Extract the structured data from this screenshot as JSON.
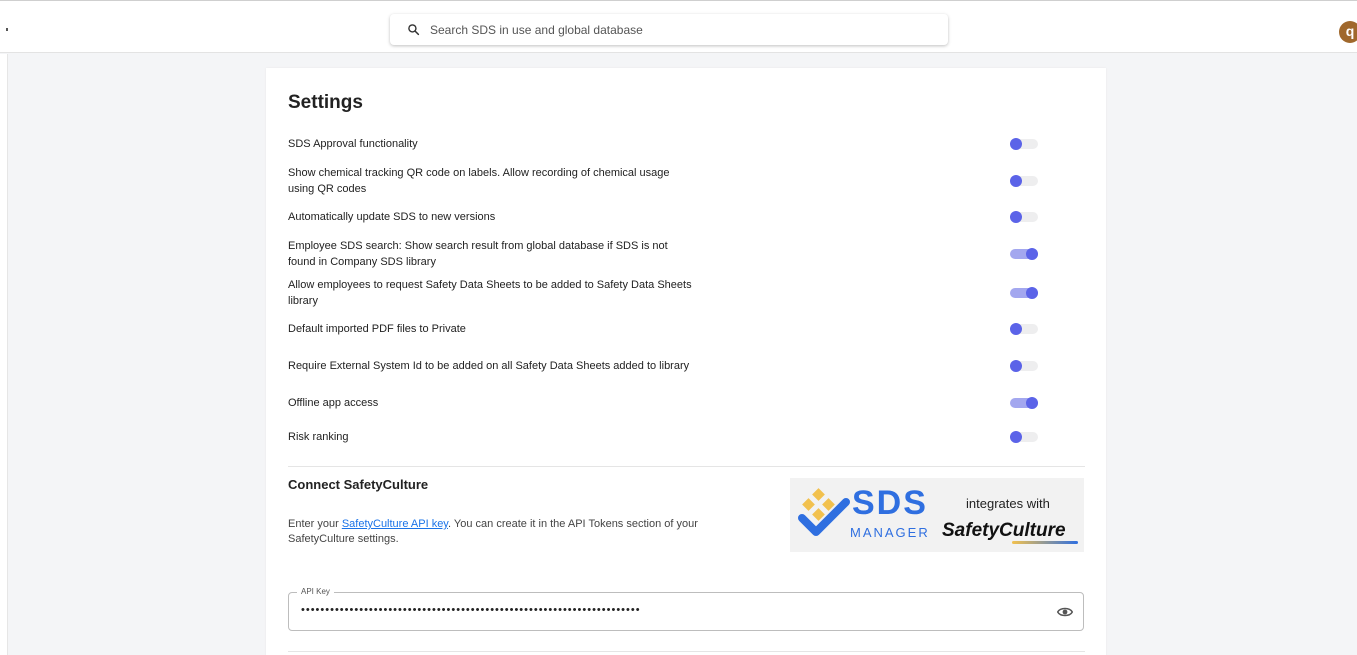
{
  "header": {
    "search_placeholder": "Search SDS in use and global database",
    "avatar_initial": "q"
  },
  "settings": {
    "title": "Settings",
    "items": [
      {
        "label": "SDS Approval functionality",
        "enabled": false
      },
      {
        "label": "Show chemical tracking QR code on labels. Allow recording of chemical usage using QR codes",
        "enabled": false
      },
      {
        "label": "Automatically update SDS to new versions",
        "enabled": false
      },
      {
        "label": "Employee SDS search: Show search result from global database if SDS is not found in Company SDS library",
        "enabled": true
      },
      {
        "label": "Allow employees to request Safety Data Sheets to be added to Safety Data Sheets library",
        "enabled": true
      },
      {
        "label": "Default imported PDF files to Private",
        "enabled": false
      },
      {
        "label": "Require External System Id to be added on all Safety Data Sheets added to library",
        "enabled": false
      },
      {
        "label": "Offline app access",
        "enabled": true
      },
      {
        "label": "Risk ranking",
        "enabled": false
      }
    ]
  },
  "connect": {
    "title": "Connect SafetyCulture",
    "desc_before": "Enter your ",
    "desc_link": "SafetyCulture API key",
    "desc_after": ". You can create it in the API Tokens section of your SafetyCulture settings.",
    "logo": {
      "sds": "SDS",
      "manager": "MANAGER",
      "integrates": "integrates with",
      "safetyculture": "SafetyCulture"
    },
    "api_key_label": "API Key",
    "api_key_value": "••••••••••••••••••••••••••••••••••••••••••••••••••••••••••••••••••••••"
  },
  "colors": {
    "accent": "#5b63e8",
    "toggle_on_track": "#a3a7ef",
    "avatar": "#a0682c",
    "link": "#1a73e8"
  }
}
